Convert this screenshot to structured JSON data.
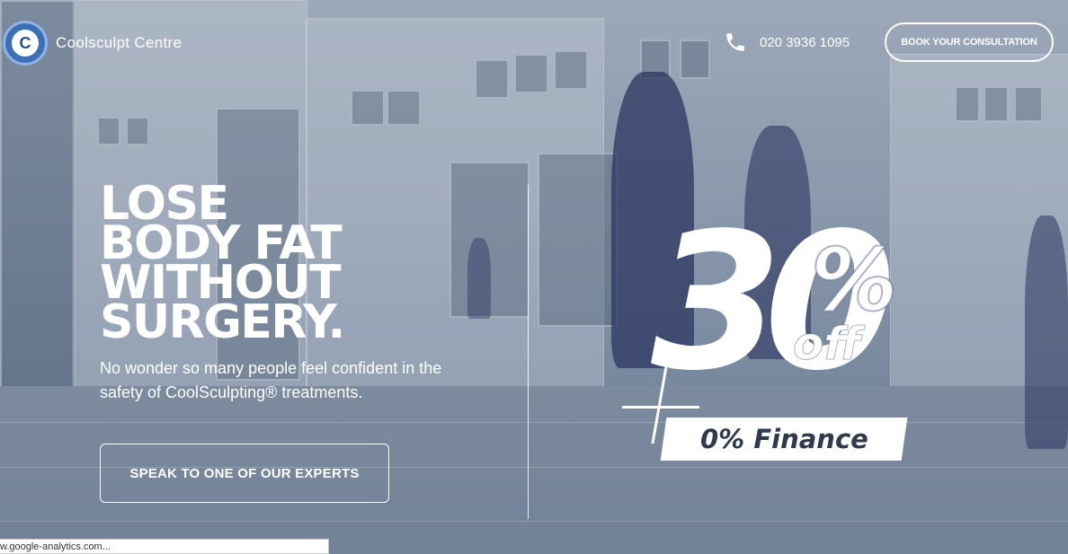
{
  "brand": {
    "logo_letter": "C",
    "name": "Coolsculpt Centre",
    "accent_color": "#3b6fb6"
  },
  "header": {
    "phone_icon": "phone-icon",
    "phone_number": "020 3936 1095",
    "book_button_label": "BOOK YOUR CONSULTATION"
  },
  "hero": {
    "headline_lines": [
      "LOSE",
      "BODY FAT",
      "WITHOUT",
      "SURGERY."
    ],
    "subtext": "No wonder so many people feel confident in the safety of CoolSculpting® treatments.",
    "cta_label": "SPEAK TO ONE OF OUR EXPERTS"
  },
  "offer": {
    "number": "30",
    "percent_sign": "%",
    "off_label": "off",
    "finance_label": "0% Finance"
  },
  "status_bar": {
    "text": "w.google-analytics.com..."
  }
}
